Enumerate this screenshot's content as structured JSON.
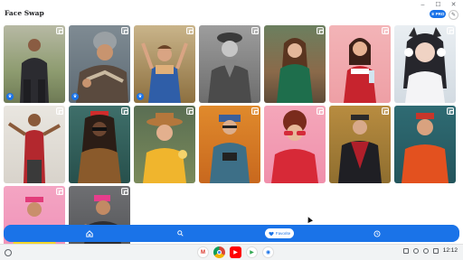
{
  "app": {
    "title": "Face Swap"
  },
  "window_controls": [
    "–",
    "☐",
    "✕"
  ],
  "header": {
    "pro_label": "PRO",
    "pro_icon": "crown-icon",
    "edit_icon": "edit-icon"
  },
  "colors": {
    "accent": "#1a73e8",
    "background": "#ffffff",
    "shelf": "#f1f3f4"
  },
  "gallery": {
    "cards": [
      {
        "name": "man-dark-hoodie",
        "premium": true
      },
      {
        "name": "man-grey-beanie",
        "premium": true
      },
      {
        "name": "girl-scarf-autumn",
        "premium": true
      },
      {
        "name": "man-flat-cap-bw",
        "premium": false
      },
      {
        "name": "woman-green-sweater",
        "premium": false
      },
      {
        "name": "woman-red-dress-pink",
        "premium": false
      },
      {
        "name": "cat-ear-girl",
        "premium": false
      },
      {
        "name": "man-red-costume",
        "premium": false
      },
      {
        "name": "man-dreadlocks",
        "premium": false
      },
      {
        "name": "woman-hat-yellow",
        "premium": false
      },
      {
        "name": "man-glasses-camera",
        "premium": false
      },
      {
        "name": "woman-red-sunglasses",
        "premium": false
      },
      {
        "name": "man-plaid-coat",
        "premium": false
      },
      {
        "name": "man-orange-jacket",
        "premium": false
      },
      {
        "name": "woman-yellow-top",
        "premium": false
      },
      {
        "name": "man-pink-beanie",
        "premium": false
      }
    ]
  },
  "bottom_nav": {
    "items": [
      {
        "icon": "home-icon"
      },
      {
        "icon": "search-icon"
      },
      {
        "icon": "heart-icon",
        "label": "Favorite",
        "active": true
      },
      {
        "icon": "history-icon"
      }
    ]
  },
  "shelf": {
    "apps": [
      "Gmail",
      "Chrome",
      "YouTube",
      "Play Store",
      "Face Swap"
    ],
    "time": "12:12"
  }
}
